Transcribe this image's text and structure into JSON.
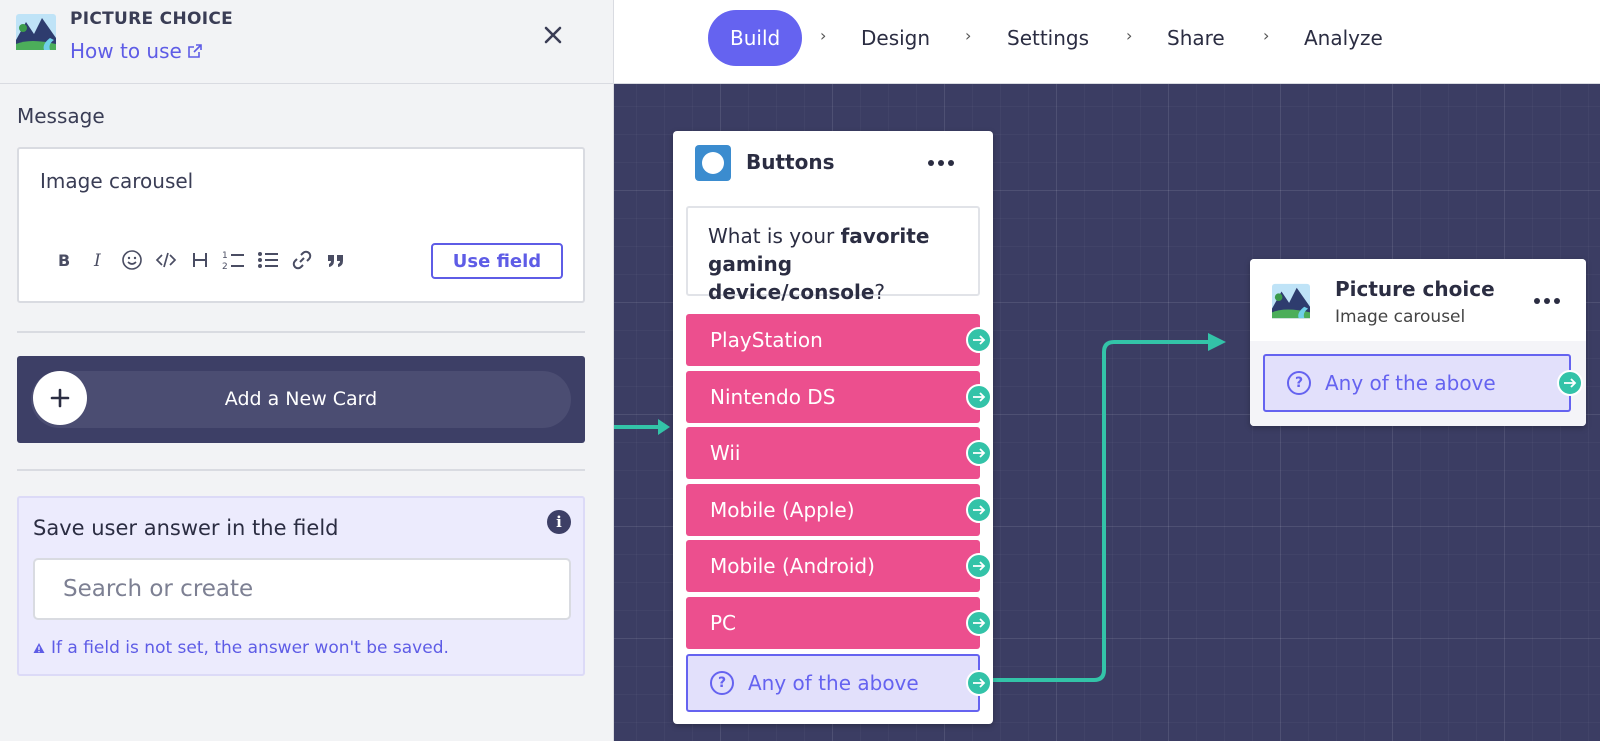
{
  "panel": {
    "type_label": "PICTURE CHOICE",
    "how_to_label": "How to use",
    "message_label": "Message",
    "message_text": "Image carousel",
    "use_field_label": "Use field",
    "add_card_label": "Add a New Card",
    "save_label": "Save user answer in the field",
    "search_placeholder": "Search or create",
    "warning_text": "If a field is not set, the answer won't be saved."
  },
  "nav": {
    "steps": [
      "Build",
      "Design",
      "Settings",
      "Share",
      "Analyze"
    ],
    "active": "Build"
  },
  "canvas": {
    "buttons_node": {
      "title": "Buttons",
      "question_plain_1": "What is your ",
      "question_bold": "favorite gaming device/console",
      "question_plain_2": "?",
      "choices": [
        "PlayStation",
        "Nintendo DS",
        "Wii",
        "Mobile (Apple)",
        "Mobile (Android)",
        "PC"
      ],
      "any_label": "Any of the above"
    },
    "picture_node": {
      "title": "Picture choice",
      "subtitle": "Image carousel",
      "any_label": "Any of the above"
    }
  },
  "colors": {
    "accent": "#6563f0",
    "choice_pink": "#ec4f8e",
    "port_teal": "#33c3a8",
    "canvas_bg": "#3b3d63"
  }
}
